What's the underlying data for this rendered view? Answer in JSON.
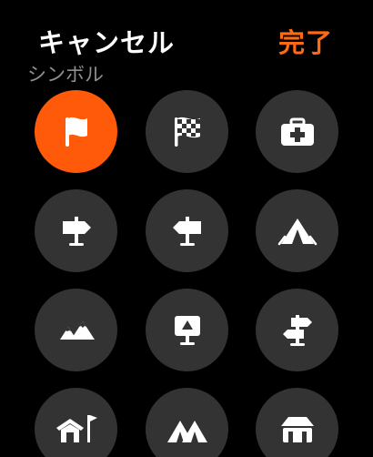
{
  "nav": {
    "cancel_label": "キャンセル",
    "done_label": "完了"
  },
  "section": {
    "label": "シンボル"
  },
  "colors": {
    "accent": "#ff6a13",
    "selected_bg": "#ff5a0a",
    "button_bg": "#333333",
    "icon": "#ffffff",
    "section_label": "#8e8e93"
  },
  "symbols": [
    {
      "icon": "flag-icon",
      "selected": true
    },
    {
      "icon": "checkered-flag-icon",
      "selected": false
    },
    {
      "icon": "first-aid-kit-icon",
      "selected": false
    },
    {
      "icon": "signpost-right-icon",
      "selected": false
    },
    {
      "icon": "signpost-left-icon",
      "selected": false
    },
    {
      "icon": "tent-icon",
      "selected": false
    },
    {
      "icon": "mountains-icon",
      "selected": false
    },
    {
      "icon": "trail-sign-icon",
      "selected": false
    },
    {
      "icon": "directional-signpost-icon",
      "selected": false
    },
    {
      "icon": "house-flag-icon",
      "selected": false
    },
    {
      "icon": "two-tents-icon",
      "selected": false
    },
    {
      "icon": "gazebo-icon",
      "selected": false
    }
  ]
}
